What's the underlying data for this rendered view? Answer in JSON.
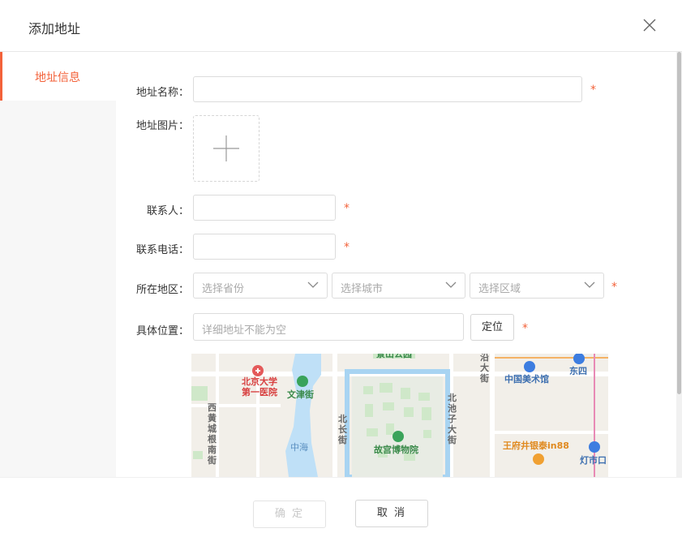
{
  "dialog": {
    "title": "添加地址"
  },
  "sidebar": {
    "items": [
      {
        "label": "地址信息",
        "active": true
      }
    ]
  },
  "form": {
    "name": {
      "label": "地址名称：",
      "value": "",
      "required": true
    },
    "image": {
      "label": "地址图片："
    },
    "contact": {
      "label": "联系人：",
      "value": "",
      "required": true
    },
    "phone": {
      "label": "联系电话：",
      "value": "",
      "required": true
    },
    "region": {
      "label": "所在地区：",
      "province_placeholder": "选择省份",
      "city_placeholder": "选择城市",
      "district_placeholder": "选择区域",
      "required": true
    },
    "location": {
      "label": "具体位置：",
      "placeholder": "详细地址不能为空",
      "locate_label": "定位",
      "required": true
    },
    "required_mark": "*"
  },
  "map": {
    "labels": {
      "hospital": "北京大学\n第一医院",
      "wenjin": "文津街",
      "xihuang": "西黄城根南街",
      "zhonghai": "中海",
      "beichang": "北长街",
      "gugong": "故宫博物院",
      "beichizi": "北池子大街",
      "meishuguan": "中国美术馆",
      "dongsi": "东四",
      "wangfujing": "王府井银泰in88",
      "dengshikou": "灯市口",
      "yandai": "沿大街",
      "jingshan": "景山公园"
    }
  },
  "footer": {
    "confirm_label": "确 定",
    "cancel_label": "取 消"
  },
  "colors": {
    "accent": "#f3623a",
    "border": "#dcdcdc"
  }
}
